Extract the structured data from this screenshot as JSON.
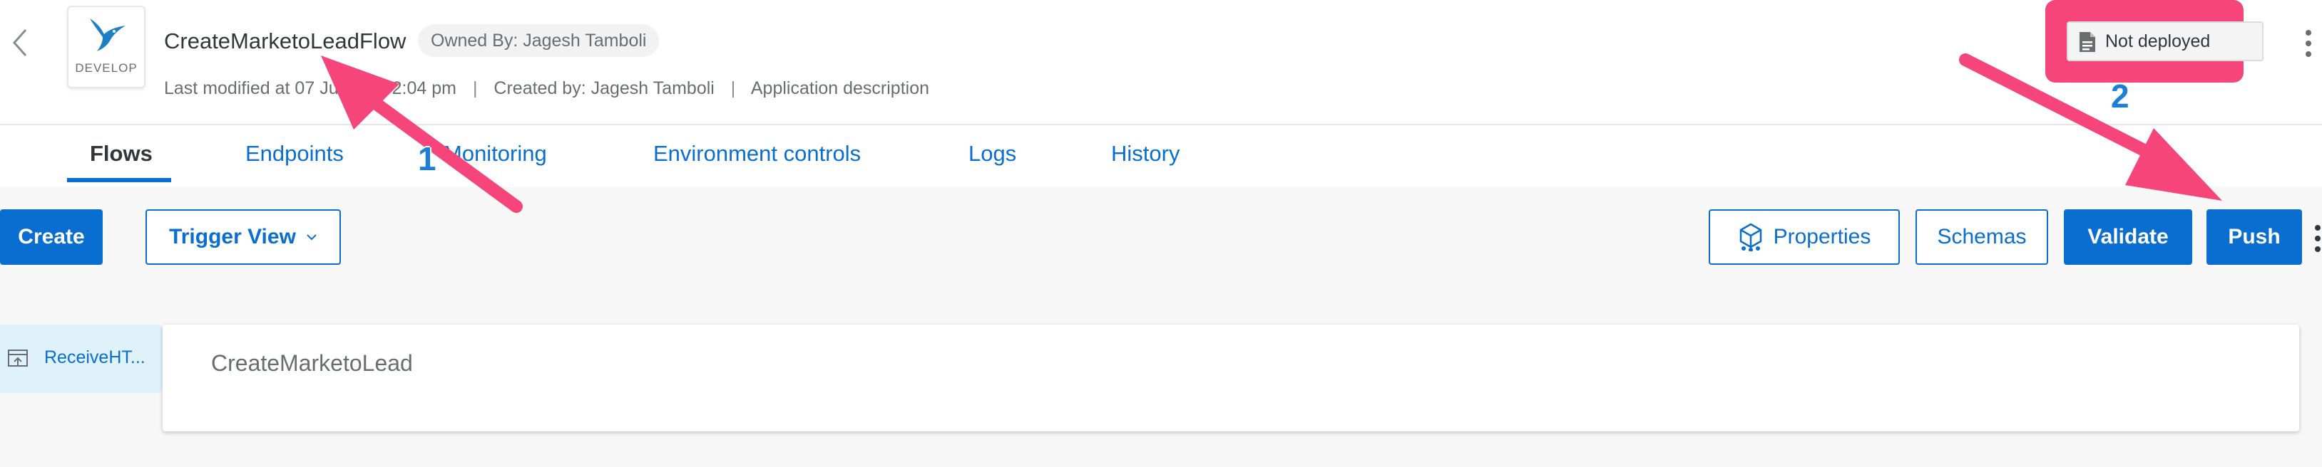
{
  "header": {
    "app_tile_label": "DEVELOP",
    "title": "CreateMarketoLeadFlow",
    "owner_badge": "Owned By: Jagesh Tamboli",
    "last_modified": "Last modified at 07 Jul 2021 2:04 pm",
    "created_by": "Created by: Jagesh Tamboli",
    "description_link": "Application description",
    "status": "Not deployed",
    "icons": [
      "chevron-left-icon",
      "hummingbird-logo",
      "document-icon",
      "more-vertical-icon"
    ]
  },
  "tabs": [
    {
      "label": "Flows",
      "active": true
    },
    {
      "label": "Endpoints",
      "active": false
    },
    {
      "label": "Monitoring",
      "active": false
    },
    {
      "label": "Environment controls",
      "active": false
    },
    {
      "label": "Logs",
      "active": false
    },
    {
      "label": "History",
      "active": false
    }
  ],
  "toolbar": {
    "create": "Create",
    "trigger_view": "Trigger View",
    "properties": "Properties",
    "schemas": "Schemas",
    "validate": "Validate",
    "push": "Push"
  },
  "flow": {
    "trigger_label": "ReceiveHT...",
    "name": "CreateMarketoLead"
  },
  "annotations": {
    "marker_1": "1",
    "marker_2": "2",
    "arrow_color": "#f5457a",
    "number_color": "#1a7fd9"
  },
  "colors": {
    "accent": "#0a6ed1",
    "text": "#32363a",
    "muted": "#6a6d70",
    "canvas_bg": "#f7f7f7",
    "trigger_bg": "#dff1fb"
  }
}
